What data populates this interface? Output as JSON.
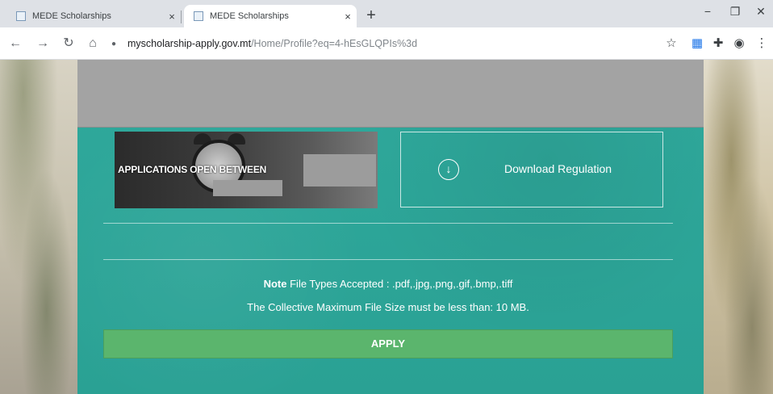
{
  "browser": {
    "tabs": [
      {
        "title": "MEDE Scholarships",
        "close": "×"
      },
      {
        "title": "MEDE Scholarships",
        "close": "×"
      }
    ],
    "new_tab": "+",
    "window_controls": [
      "−",
      "❐",
      "✕"
    ],
    "nav": {
      "back": "←",
      "forward": "→",
      "reload": "↻",
      "home": "⌂"
    },
    "url_domain": "myscholarship-apply.gov.mt",
    "url_path": "/Home/Profile?eq=4-hEsGLQPIs%3d",
    "toolbar_icons": {
      "star": "☆",
      "extension": "▦",
      "puzzle": "✚",
      "profile": "◉",
      "menu": "⋮"
    }
  },
  "page": {
    "banner_text": "APPLICATIONS  OPEN  BETWEEN",
    "download_icon": "↓",
    "download_label": "Download Regulation",
    "note_label": "Note",
    "file_types": "File Types Accepted : .pdf,.jpg,.png,.gif,.bmp,.tiff",
    "max_size": "The Collective Maximum File Size must be less than: 10 MB.",
    "apply_label": "APPLY"
  },
  "colors": {
    "panel": "#2ea89b",
    "apply_button": "#5bb56d",
    "redaction": "#a3a3a3"
  }
}
